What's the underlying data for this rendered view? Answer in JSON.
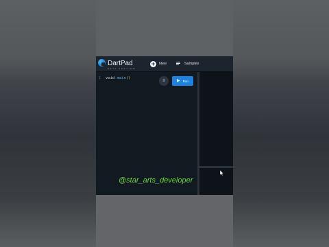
{
  "app": {
    "title": "DartPad",
    "tagline": "BETA PREVIEW",
    "new_label": "New",
    "samples_label": "Samples",
    "run_label": "Run",
    "brand_color": "#1c83e0",
    "icons": [
      "dart-logo-icon",
      "plus-circle-icon",
      "playlist-icon",
      "format-icon",
      "play-icon",
      "mouse-cursor-icon"
    ]
  },
  "editor": {
    "line_number": "1",
    "code_keyword": "void ",
    "code_function": "main",
    "code_parens": "()"
  },
  "overlay": {
    "watermark": "@star_arts_developer",
    "watermark_color": "#6ed03f"
  }
}
